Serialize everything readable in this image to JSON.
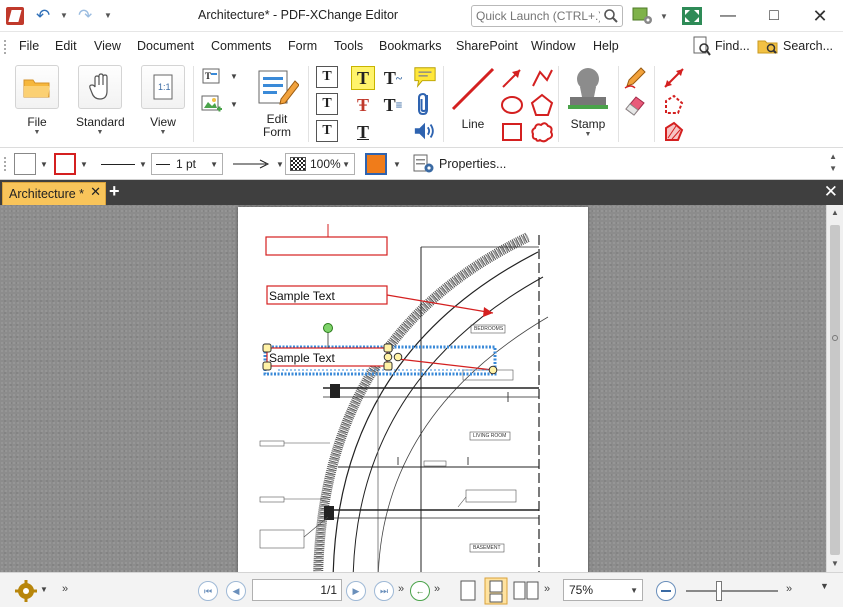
{
  "window": {
    "title": "Architecture* - PDF-XChange Editor",
    "quick_launch_placeholder": "Quick Launch (CTRL+.)"
  },
  "menu": {
    "items": [
      "File",
      "Edit",
      "View",
      "Document",
      "Comments",
      "Form",
      "Tools",
      "Bookmarks",
      "SharePoint",
      "Window",
      "Help"
    ],
    "find_label": "Find...",
    "search_label": "Search..."
  },
  "ribbon": {
    "file_label": "File",
    "standard_label": "Standard",
    "view_label": "View",
    "edit_form_label_1": "Edit",
    "edit_form_label_2": "Form",
    "line_label": "Line",
    "stamp_label": "Stamp"
  },
  "properties_bar": {
    "line_width": "1 pt",
    "opacity": "100%",
    "properties_label": "Properties..."
  },
  "document_tab": {
    "label": "Architecture *"
  },
  "page": {
    "annotations": {
      "sample_text_1": "Sample Text",
      "sample_text_2": "Sample Text"
    },
    "room_labels": {
      "bedrooms": "BEDROOMS",
      "living_room": "LIVING ROOM",
      "basement": "BASEMENT"
    }
  },
  "statusbar": {
    "page_indicator": "1/1",
    "zoom": "75%"
  },
  "colors": {
    "accent_tab": "#f8c45a",
    "annotation_red": "#d42020",
    "selection_blue": "#3a8ad8"
  }
}
